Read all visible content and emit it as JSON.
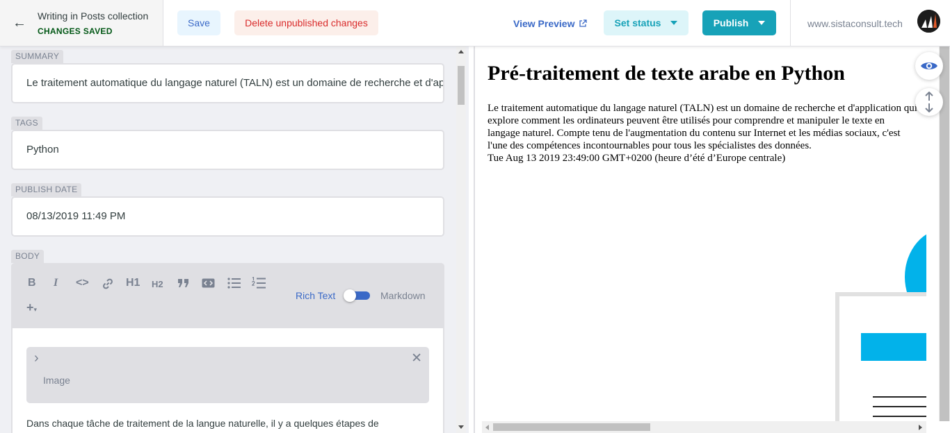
{
  "header": {
    "collection_title": "Writing in Posts collection",
    "save_status": "CHANGES SAVED",
    "save_label": "Save",
    "delete_label": "Delete unpublished changes",
    "view_preview_label": "View Preview",
    "set_status_label": "Set status",
    "publish_label": "Publish",
    "site_url": "www.sistaconsult.tech"
  },
  "fields": {
    "summary": {
      "label": "SUMMARY",
      "value": "Le traitement automatique du langage naturel (TALN) est un domaine de recherche et d'application"
    },
    "tags": {
      "label": "TAGS",
      "value": "Python"
    },
    "publish_date": {
      "label": "PUBLISH DATE",
      "value": "08/13/2019 11:49 PM"
    },
    "body": {
      "label": "BODY",
      "toolbar": {
        "bold": "B",
        "italic": "I",
        "code": "<>",
        "h1": "H1",
        "h2": "H2",
        "rich_text_label": "Rich Text",
        "markdown_label": "Markdown",
        "add": "+"
      },
      "image_widget_label": "Image",
      "text": "Dans chaque tâche de traitement de la langue naturelle, il y a quelques étapes de"
    }
  },
  "preview": {
    "title": "Pré-traitement de texte arabe en Python",
    "summary": "Le traitement automatique du langage naturel (TALN) est un domaine de recherche et d'application qui explore comment les ordinateurs peuvent être utilisés pour comprendre et manipuler le texte en langage naturel. Compte tenu de l'augmentation du contenu sur Internet et les médias sociaux, c'est l'une des compétences incontournables pour tous les spécialistes des données.",
    "date": "Tue Aug 13 2019 23:49:00 GMT+0200 (heure d’été d’Europe centrale)"
  },
  "colors": {
    "accent": "#17a2b8",
    "link": "#3a69c7",
    "danger": "#d92b2b",
    "success": "#005614",
    "deco_blue": "#02b2ea"
  }
}
